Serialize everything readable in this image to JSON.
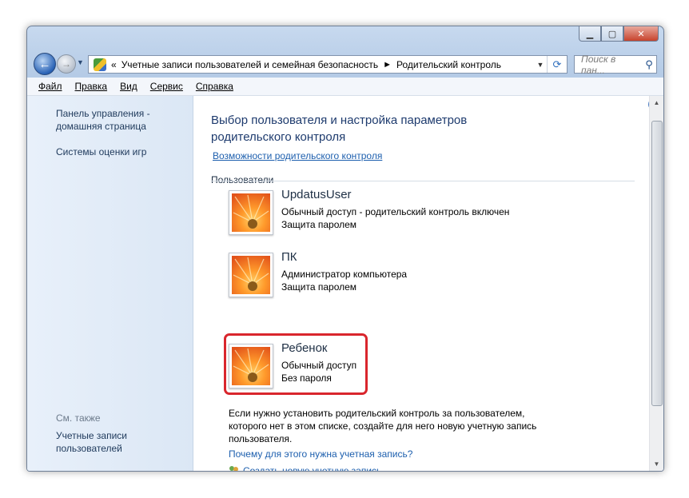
{
  "address": {
    "prefix": "«",
    "crumb1": "Учетные записи пользователей и семейная безопасность",
    "crumb2": "Родительский контроль",
    "search_placeholder": "Поиск в пан..."
  },
  "menu": [
    "Файл",
    "Правка",
    "Вид",
    "Сервис",
    "Справка"
  ],
  "sidebar": {
    "home": "Панель управления - домашняя страница",
    "games": "Системы оценки игр",
    "see_also": "См. также",
    "user_accounts": "Учетные записи пользователей"
  },
  "main": {
    "title": "Выбор пользователя и настройка параметров родительского контроля",
    "features_link": "Возможности родительского контроля",
    "users_section": "Пользователи",
    "users": [
      {
        "name": "UpdatusUser",
        "line1": "Обычный доступ - родительский контроль включен",
        "line2": "Защита паролем"
      },
      {
        "name": "ПК",
        "line1": "Администратор компьютера",
        "line2": "Защита паролем"
      },
      {
        "name": "Ребенок",
        "line1": "Обычный доступ",
        "line2": "Без пароля",
        "highlighted": true
      }
    ],
    "note": "Если нужно установить родительский контроль за пользователем, которого нет в этом списке, создайте для него новую учетную запись пользователя.",
    "why_link": "Почему для этого нужна учетная запись?",
    "create_link": "Создать новую учетную запись"
  },
  "colors": {
    "highlight": "#d9262d",
    "link": "#1d5fae",
    "title": "#1e3b6e"
  }
}
